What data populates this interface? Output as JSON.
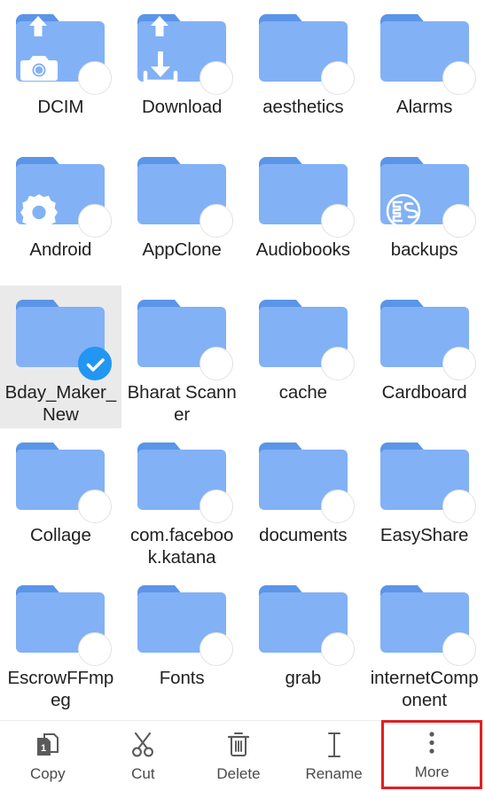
{
  "screen": {
    "app": "file-manager",
    "background": "#ffffff",
    "folder_body_color": "#82b1f5",
    "folder_tab_color": "#5b95e8",
    "selection_background": "#eaeaea",
    "selection_check_color": "#2196f3",
    "highlight_box_color": "#e02020",
    "label_color": "#212121",
    "toolbar_icon_color": "#5a5a5a"
  },
  "grid": {
    "columns": 4,
    "items": [
      {
        "name": "DCIM",
        "glyph": "camera-icon",
        "tab_badge": "upload-arrow-icon",
        "selected": false
      },
      {
        "name": "Download",
        "glyph": "download-icon",
        "tab_badge": "upload-arrow-icon",
        "selected": false
      },
      {
        "name": "aesthetics",
        "glyph": "none",
        "tab_badge": "none",
        "selected": false
      },
      {
        "name": "Alarms",
        "glyph": "none",
        "tab_badge": "none",
        "selected": false
      },
      {
        "name": "Android",
        "glyph": "gear-icon",
        "tab_badge": "none",
        "selected": false
      },
      {
        "name": "AppClone",
        "glyph": "none",
        "tab_badge": "none",
        "selected": false
      },
      {
        "name": "Audiobooks",
        "glyph": "none",
        "tab_badge": "none",
        "selected": false
      },
      {
        "name": "backups",
        "glyph": "es-logo-icon",
        "tab_badge": "none",
        "selected": false
      },
      {
        "name": "Bday_Maker_New",
        "glyph": "none",
        "tab_badge": "none",
        "selected": true
      },
      {
        "name": "Bharat Scanner",
        "glyph": "none",
        "tab_badge": "none",
        "selected": false
      },
      {
        "name": "cache",
        "glyph": "none",
        "tab_badge": "none",
        "selected": false
      },
      {
        "name": "Cardboard",
        "glyph": "none",
        "tab_badge": "none",
        "selected": false
      },
      {
        "name": "Collage",
        "glyph": "none",
        "tab_badge": "none",
        "selected": false
      },
      {
        "name": "com.facebook.katana",
        "glyph": "none",
        "tab_badge": "none",
        "selected": false
      },
      {
        "name": "documents",
        "glyph": "none",
        "tab_badge": "none",
        "selected": false
      },
      {
        "name": "EasyShare",
        "glyph": "none",
        "tab_badge": "none",
        "selected": false
      },
      {
        "name": "EscrowFFmpeg",
        "glyph": "none",
        "tab_badge": "none",
        "selected": false
      },
      {
        "name": "Fonts",
        "glyph": "none",
        "tab_badge": "none",
        "selected": false
      },
      {
        "name": "grab",
        "glyph": "none",
        "tab_badge": "none",
        "selected": false
      },
      {
        "name": "internetComponent",
        "glyph": "none",
        "tab_badge": "none",
        "selected": false
      }
    ]
  },
  "toolbar": {
    "items": [
      {
        "label": "Copy",
        "icon": "copy-icon",
        "badge_count": "1",
        "highlighted": false
      },
      {
        "label": "Cut",
        "icon": "scissors-icon",
        "badge_count": "",
        "highlighted": false
      },
      {
        "label": "Delete",
        "icon": "trash-icon",
        "badge_count": "",
        "highlighted": false
      },
      {
        "label": "Rename",
        "icon": "text-cursor-icon",
        "badge_count": "",
        "highlighted": false
      },
      {
        "label": "More",
        "icon": "more-vert-icon",
        "badge_count": "",
        "highlighted": true
      }
    ]
  }
}
